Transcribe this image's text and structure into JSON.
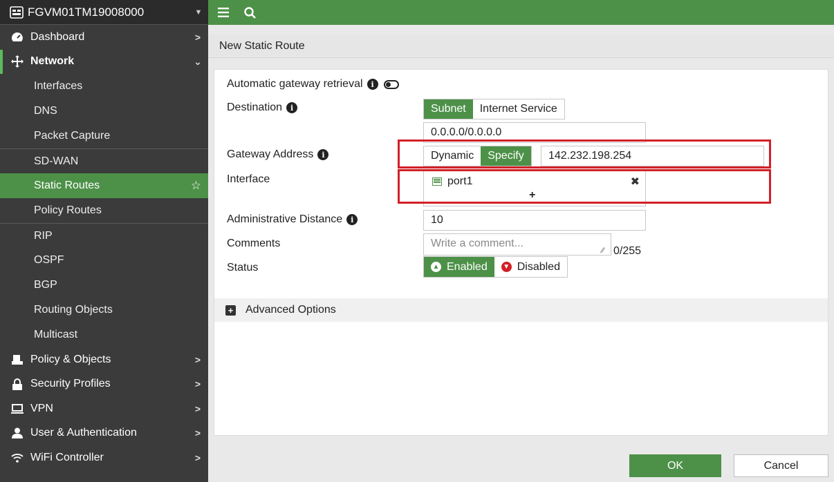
{
  "device": {
    "name": "FGVM01TM19008000"
  },
  "sidebar": {
    "items": [
      {
        "label": "Dashboard",
        "icon": "dashboard-icon"
      },
      {
        "label": "Network",
        "icon": "network-icon",
        "open": true
      },
      {
        "label": "Policy & Objects",
        "icon": "policy-icon"
      },
      {
        "label": "Security Profiles",
        "icon": "lock-icon"
      },
      {
        "label": "VPN",
        "icon": "vpn-icon"
      },
      {
        "label": "User & Authentication",
        "icon": "user-icon"
      },
      {
        "label": "WiFi Controller",
        "icon": "wifi-icon"
      }
    ],
    "network_sub": [
      {
        "label": "Interfaces"
      },
      {
        "label": "DNS"
      },
      {
        "label": "Packet Capture"
      },
      {
        "label": "SD-WAN"
      },
      {
        "label": "Static Routes",
        "active": true
      },
      {
        "label": "Policy Routes"
      },
      {
        "label": "RIP"
      },
      {
        "label": "OSPF"
      },
      {
        "label": "BGP"
      },
      {
        "label": "Routing Objects"
      },
      {
        "label": "Multicast"
      }
    ]
  },
  "breadcrumb": {
    "title": "New Static Route"
  },
  "form": {
    "auto_gateway_label": "Automatic gateway retrieval",
    "destination_label": "Destination",
    "destination_options": [
      "Subnet",
      "Internet Service"
    ],
    "destination_value": "0.0.0.0/0.0.0.0",
    "gateway_label": "Gateway Address",
    "gateway_options": [
      "Dynamic",
      "Specify"
    ],
    "gateway_value": "142.232.198.254",
    "interface_label": "Interface",
    "interface_value": "port1",
    "interface_add": "+",
    "interface_remove": "✖",
    "admin_distance_label": "Administrative Distance",
    "admin_distance_value": "10",
    "comments_label": "Comments",
    "comments_placeholder": "Write a comment...",
    "comments_counter": "0/255",
    "status_label": "Status",
    "status_enabled": "Enabled",
    "status_disabled": "Disabled",
    "advanced_label": "Advanced Options"
  },
  "buttons": {
    "ok": "OK",
    "cancel": "Cancel"
  },
  "colors": {
    "accent": "#4d9148",
    "sidebar": "#3b3b3b",
    "highlight": "#d21f27"
  }
}
